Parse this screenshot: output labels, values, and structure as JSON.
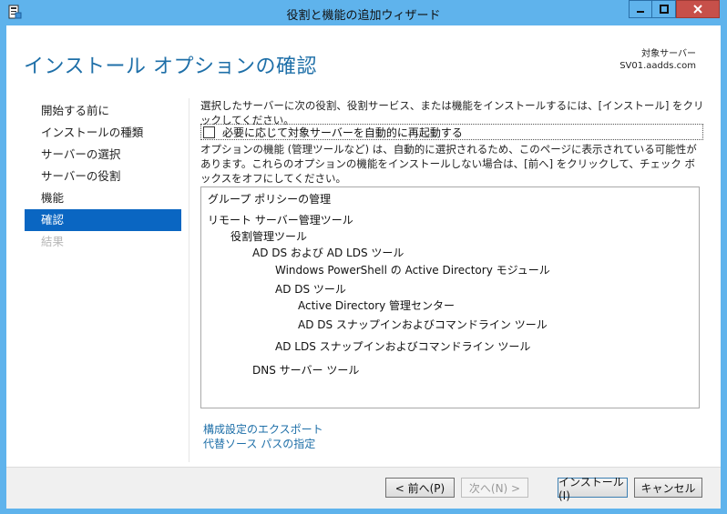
{
  "window": {
    "title": "役割と機能の追加ウィザード",
    "controls": {
      "minimize": "_",
      "maximize": "□",
      "close": "X"
    }
  },
  "header": {
    "title": "インストール オプションの確認",
    "target_label": "対象サーバー",
    "target_server": "SV01.aadds.com"
  },
  "nav": {
    "items": [
      {
        "label": "開始する前に",
        "state": "normal"
      },
      {
        "label": "インストールの種類",
        "state": "normal"
      },
      {
        "label": "サーバーの選択",
        "state": "normal"
      },
      {
        "label": "サーバーの役割",
        "state": "normal"
      },
      {
        "label": "機能",
        "state": "normal"
      },
      {
        "label": "確認",
        "state": "active"
      },
      {
        "label": "結果",
        "state": "disabled"
      }
    ]
  },
  "main": {
    "intro": "選択したサーバーに次の役割、役割サービス、または機能をインストールするには、[インストール] をクリックしてください。",
    "restart_checkbox": {
      "label": "必要に応じて対象サーバーを自動的に再起動する",
      "checked": false
    },
    "note": "オプションの機能 (管理ツールなど) は、自動的に選択されるため、このページに表示されている可能性があります。これらのオプションの機能をインストールしない場合は、[前へ] をクリックして、チェック ボックスをオフにしてください。",
    "features": [
      {
        "label": "グループ ポリシーの管理",
        "level": 0
      },
      {
        "label": "リモート サーバー管理ツール",
        "level": 0
      },
      {
        "label": "役割管理ツール",
        "level": 1
      },
      {
        "label": "AD DS および AD LDS ツール",
        "level": 2
      },
      {
        "label": "Windows PowerShell の Active Directory モジュール",
        "level": 3
      },
      {
        "label": "AD DS ツール",
        "level": 3
      },
      {
        "label": "Active Directory 管理センター",
        "level": 4
      },
      {
        "label": "AD DS スナップインおよびコマンドライン ツール",
        "level": 4
      },
      {
        "label": "AD LDS スナップインおよびコマンドライン ツール",
        "level": 3
      },
      {
        "label": "DNS サーバー ツール",
        "level": 2
      }
    ],
    "links": {
      "export": "構成設定のエクスポート",
      "alt_source": "代替ソース パスの指定"
    }
  },
  "footer": {
    "prev": "< 前へ(P)",
    "next": "次へ(N) >",
    "install": "インストール(I)",
    "cancel": "キャンセル"
  },
  "colors": {
    "title_bar": "#5fb3ec",
    "accent": "#1e6fa8",
    "nav_active": "#0a66c2",
    "close_button": "#c7504a"
  }
}
